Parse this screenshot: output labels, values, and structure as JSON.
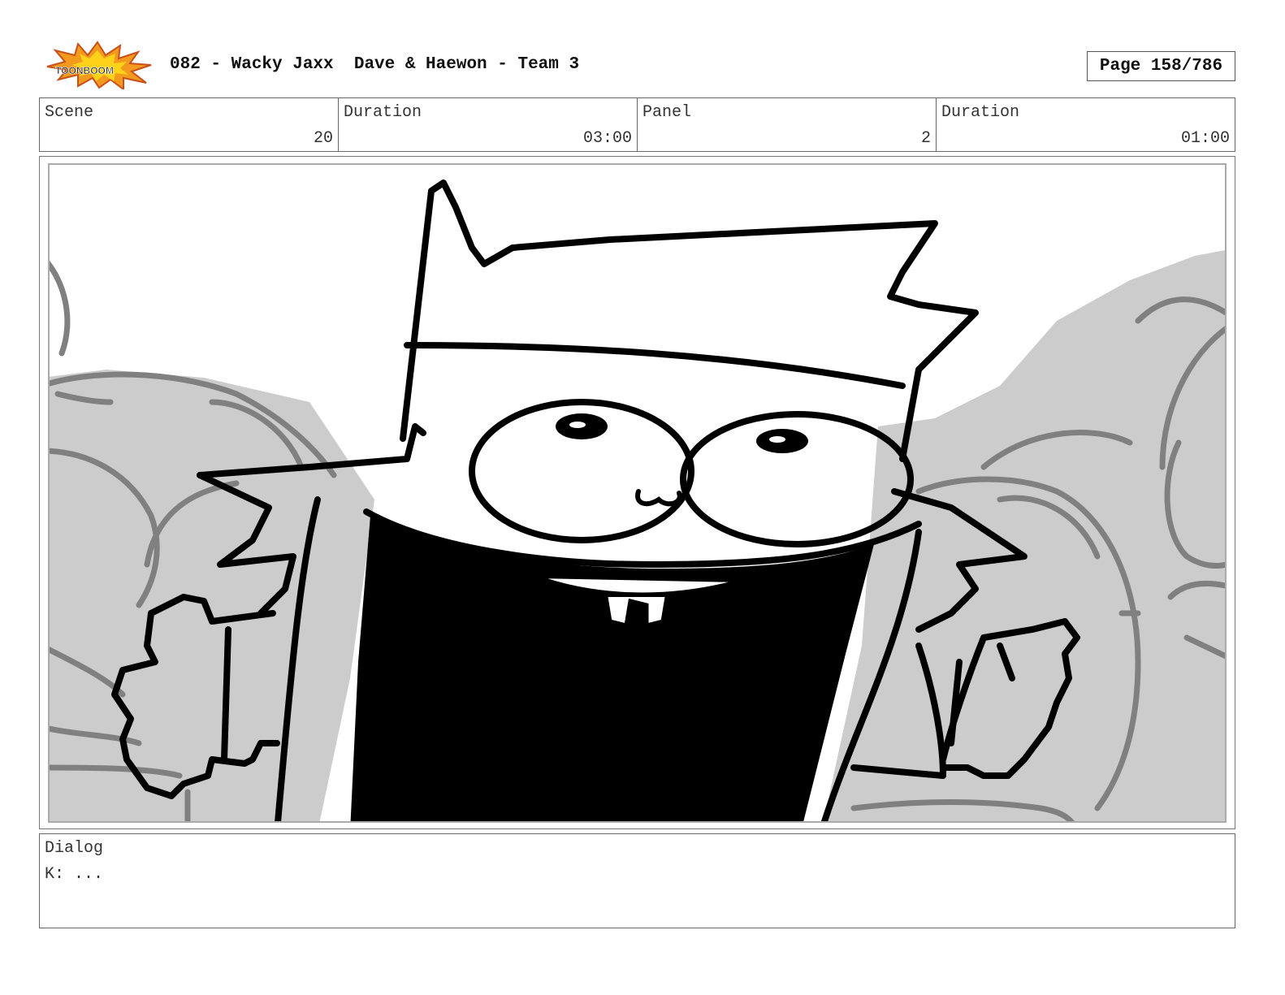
{
  "header": {
    "logo_text": "TOONBOOM",
    "title": "082 - Wacky Jaxx  Dave & Haewon - Team 3",
    "page": "Page 158/786"
  },
  "info": {
    "scene_label": "Scene",
    "scene_value": "20",
    "scene_duration_label": "Duration",
    "scene_duration_value": "03:00",
    "panel_label": "Panel",
    "panel_value": "2",
    "panel_duration_label": "Duration",
    "panel_duration_value": "01:00"
  },
  "panel": {
    "image": "storyboard-sketch-character-arms-open",
    "colors": {
      "ink": "#000000",
      "background_tone": "#cccccc",
      "background_line": "#808080"
    }
  },
  "dialog": {
    "label": "Dialog",
    "text": "K: ..."
  }
}
